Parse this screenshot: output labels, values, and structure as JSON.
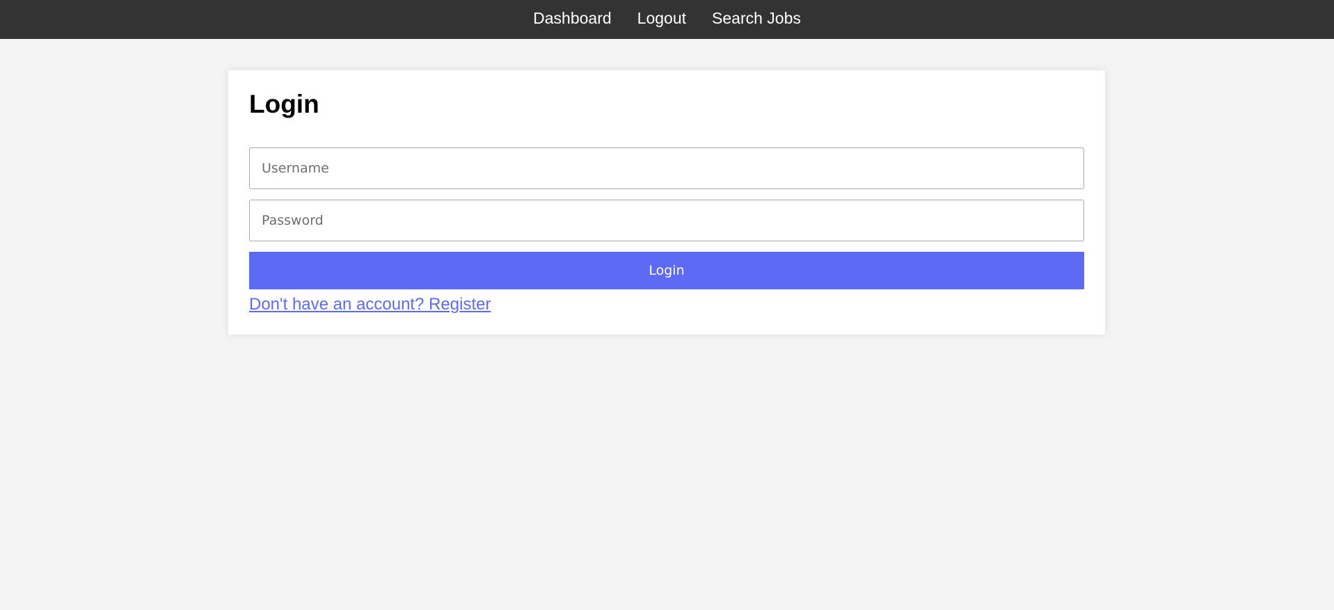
{
  "nav": {
    "items": [
      {
        "label": "Dashboard"
      },
      {
        "label": "Logout"
      },
      {
        "label": "Search Jobs"
      }
    ]
  },
  "login": {
    "title": "Login",
    "username": {
      "placeholder": "Username",
      "value": ""
    },
    "password": {
      "placeholder": "Password",
      "value": ""
    },
    "submit_label": "Login",
    "register_link": "Don't have an account? Register"
  },
  "colors": {
    "nav_background": "#333333",
    "page_background": "#f4f4f4",
    "accent": "#5d6af3",
    "card_background": "#ffffff"
  }
}
